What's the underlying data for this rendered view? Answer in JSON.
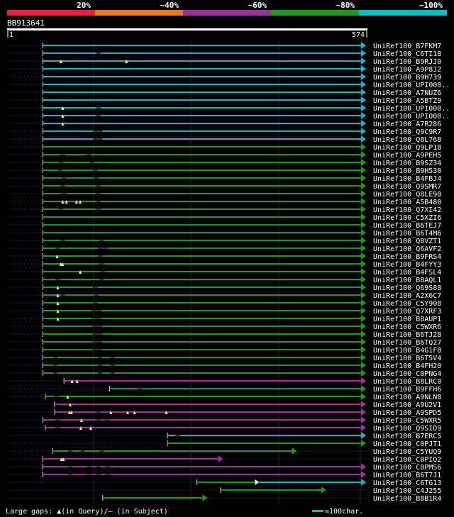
{
  "query": {
    "id": "BB913641",
    "start": "1",
    "end": "574"
  },
  "identity_scale": {
    "segments": [
      {
        "label": "20%",
        "color": "#e8213a"
      },
      {
        "label": "~40%",
        "color": "#e9781e"
      },
      {
        "label": "~60%",
        "color": "#9a2fa0"
      },
      {
        "label": "~80%",
        "color": "#1d9a1d"
      },
      {
        "label": "~100%",
        "color": "#13b8c8"
      }
    ]
  },
  "colors": {
    "background": "#000000",
    "cyan": "#13b8c8",
    "green": "#1d9a1d",
    "purple": "#a0309e",
    "white": "#ffffff",
    "grid": "#222222",
    "dotted": "#1d1d3a",
    "triangle": "#ffff66"
  },
  "legend": {
    "gaps_text": "Large gaps: ▲(in Query)/– (in Subject)",
    "scale_text": "=100char."
  },
  "hits": [
    {
      "label": "UniRef100_B7FKM7",
      "color": "cyan",
      "q_start": 56,
      "q_end": 574,
      "gaps": [],
      "thin": []
    },
    {
      "label": "UniRef100_C6TI18",
      "color": "cyan",
      "q_start": 56,
      "q_end": 574,
      "gaps": [],
      "thin": [
        145
      ]
    },
    {
      "label": "UniRef100_B9RJJ0",
      "color": "cyan",
      "q_start": 56,
      "q_end": 574,
      "gaps": [
        85,
        190
      ],
      "thin": []
    },
    {
      "label": "UniRef100_A9P8J2",
      "color": "cyan",
      "q_start": 56,
      "q_end": 574,
      "gaps": [],
      "thin": []
    },
    {
      "label": "UniRef100_B9H739",
      "color": "cyan",
      "q_start": 56,
      "q_end": 574,
      "gaps": [],
      "thin": []
    },
    {
      "label": "UniRef100_UPI000..",
      "color": "cyan",
      "q_start": 56,
      "q_end": 574,
      "gaps": [],
      "thin": []
    },
    {
      "label": "UniRef100_A7NUZ6",
      "color": "cyan",
      "q_start": 56,
      "q_end": 574,
      "gaps": [],
      "thin": []
    },
    {
      "label": "UniRef100_A5BTZ9",
      "color": "cyan",
      "q_start": 56,
      "q_end": 574,
      "gaps": [],
      "thin": []
    },
    {
      "label": "UniRef100_UPI000..",
      "color": "cyan",
      "q_start": 56,
      "q_end": 574,
      "gaps": [
        88
      ],
      "thin": [
        145
      ]
    },
    {
      "label": "UniRef100_UPI000..",
      "color": "cyan",
      "q_start": 56,
      "q_end": 574,
      "gaps": [
        88
      ],
      "thin": [
        145
      ]
    },
    {
      "label": "UniRef100_A7R286",
      "color": "cyan",
      "q_start": 56,
      "q_end": 574,
      "gaps": [
        88
      ],
      "thin": []
    },
    {
      "label": "UniRef100_Q9C9R7",
      "color": "cyan",
      "q_start": 56,
      "q_end": 574,
      "gaps": [],
      "thin": [
        140,
        148
      ]
    },
    {
      "label": "UniRef100_Q8L768",
      "color": "cyan",
      "q_start": 56,
      "q_end": 574,
      "gaps": [],
      "thin": [
        140,
        148
      ]
    },
    {
      "label": "UniRef100_Q9LP18",
      "color": "green",
      "q_start": 56,
      "q_end": 574,
      "gaps": [],
      "thin": []
    },
    {
      "label": "UniRef100_A9PEH5",
      "color": "green",
      "q_start": 56,
      "q_end": 574,
      "gaps": [],
      "thin": [
        88,
        130
      ]
    },
    {
      "label": "UniRef100_B9SZ34",
      "color": "green",
      "q_start": 56,
      "q_end": 574,
      "gaps": [],
      "thin": [
        85,
        135
      ]
    },
    {
      "label": "UniRef100_B9H530",
      "color": "green",
      "q_start": 56,
      "q_end": 574,
      "gaps": [],
      "thin": [
        84,
        140
      ]
    },
    {
      "label": "UniRef100_B4FBJ4",
      "color": "green",
      "q_start": 56,
      "q_end": 574,
      "gaps": [],
      "thin": [
        90,
        142
      ]
    },
    {
      "label": "UniRef100_Q9SMR7",
      "color": "green",
      "q_start": 56,
      "q_end": 574,
      "gaps": [],
      "thin": [
        88,
        145
      ]
    },
    {
      "label": "UniRef100_Q8LE90",
      "color": "green",
      "q_start": 56,
      "q_end": 574,
      "gaps": [],
      "thin": [
        90,
        145
      ]
    },
    {
      "label": "UniRef100_A5B480",
      "color": "green",
      "q_start": 56,
      "q_end": 574,
      "gaps": [
        88,
        94,
        110,
        116
      ],
      "thin": [
        145
      ]
    },
    {
      "label": "UniRef100_Q7XI42",
      "color": "green",
      "q_start": 56,
      "q_end": 574,
      "gaps": [],
      "thin": [
        85,
        145
      ]
    },
    {
      "label": "UniRef100_C5XZI6",
      "color": "green",
      "q_start": 56,
      "q_end": 574,
      "gaps": [],
      "thin": []
    },
    {
      "label": "UniRef100_B6TEJ7",
      "color": "green",
      "q_start": 56,
      "q_end": 574,
      "gaps": [],
      "thin": []
    },
    {
      "label": "UniRef100_B6T4M6",
      "color": "green",
      "q_start": 56,
      "q_end": 574,
      "gaps": [],
      "thin": []
    },
    {
      "label": "UniRef100_Q8VZT1",
      "color": "green",
      "q_start": 56,
      "q_end": 574,
      "gaps": [],
      "thin": [
        88,
        150
      ]
    },
    {
      "label": "UniRef100_Q6AVF2",
      "color": "green",
      "q_start": 56,
      "q_end": 574,
      "gaps": [],
      "thin": [
        80,
        148,
        156
      ]
    },
    {
      "label": "UniRef100_B9FRS4",
      "color": "green",
      "q_start": 56,
      "q_end": 574,
      "gaps": [
        79
      ],
      "thin": [
        148
      ]
    },
    {
      "label": "UniRef100_B4FYY3",
      "color": "green",
      "q_start": 56,
      "q_end": 574,
      "gaps": [
        85,
        88
      ],
      "thin": [
        150
      ]
    },
    {
      "label": "UniRef100_B4FSL4",
      "color": "green",
      "q_start": 56,
      "q_end": 574,
      "gaps": [
        116
      ],
      "thin": [
        152
      ]
    },
    {
      "label": "UniRef100_B8AQL1",
      "color": "green",
      "q_start": 56,
      "q_end": 574,
      "gaps": [],
      "thin": [
        80,
        150
      ]
    },
    {
      "label": "UniRef100_Q69S88",
      "color": "green",
      "q_start": 56,
      "q_end": 574,
      "gaps": [
        80
      ],
      "thin": [
        140
      ]
    },
    {
      "label": "UniRef100_A2X6C7",
      "color": "green",
      "q_start": 56,
      "q_end": 574,
      "gaps": [
        80
      ],
      "thin": [
        88,
        142
      ]
    },
    {
      "label": "UniRef100_C5Y908",
      "color": "green",
      "q_start": 56,
      "q_end": 574,
      "gaps": [
        80
      ],
      "thin": [
        140
      ]
    },
    {
      "label": "UniRef100_Q7XRF3",
      "color": "green",
      "q_start": 56,
      "q_end": 574,
      "gaps": [
        80
      ],
      "thin": [
        138,
        146
      ]
    },
    {
      "label": "UniRef100_B8AUP1",
      "color": "green",
      "q_start": 56,
      "q_end": 574,
      "gaps": [
        80
      ],
      "thin": [
        138,
        146
      ]
    },
    {
      "label": "UniRef100_C5WXR6",
      "color": "green",
      "q_start": 56,
      "q_end": 574,
      "gaps": [],
      "thin": [
        140,
        148
      ]
    },
    {
      "label": "UniRef100_B6TJ28",
      "color": "green",
      "q_start": 56,
      "q_end": 574,
      "gaps": [],
      "thin": [
        140,
        148
      ]
    },
    {
      "label": "UniRef100_B6TQ27",
      "color": "green",
      "q_start": 56,
      "q_end": 574,
      "gaps": [],
      "thin": [
        140,
        148
      ]
    },
    {
      "label": "UniRef100_B4G1F8",
      "color": "green",
      "q_start": 56,
      "q_end": 574,
      "gaps": [],
      "thin": [
        140,
        148
      ]
    },
    {
      "label": "UniRef100_B6T5V4",
      "color": "green",
      "q_start": 56,
      "q_end": 574,
      "gaps": [],
      "thin": [
        76,
        148,
        168
      ]
    },
    {
      "label": "UniRef100_B4FH20",
      "color": "green",
      "q_start": 56,
      "q_end": 574,
      "gaps": [],
      "thin": [
        76,
        148,
        168
      ]
    },
    {
      "label": "UniRef100_C0PNG4",
      "color": "green",
      "q_start": 56,
      "q_end": 574,
      "gaps": [],
      "thin": [
        76,
        148,
        168
      ]
    },
    {
      "label": "UniRef100_B8LRC0",
      "color": "purple",
      "q_start": 90,
      "q_end": 574,
      "gaps": [
        103,
        111
      ],
      "thin": []
    },
    {
      "label": "UniRef100_B9FFH6",
      "color": "green",
      "q_start": 163,
      "q_end": 574,
      "gaps": [],
      "thin": [
        212
      ]
    },
    {
      "label": "UniRef100_A9NLN8",
      "color": "green",
      "q_start": 60,
      "q_end": 574,
      "gaps": [
        96
      ],
      "thin": [
        78
      ]
    },
    {
      "label": "UniRef100_A9U2V1",
      "color": "purple",
      "q_start": 75,
      "q_end": 574,
      "gaps": [
        100
      ],
      "thin": []
    },
    {
      "label": "UniRef100_A9SPD5",
      "color": "purple",
      "q_start": 75,
      "q_end": 574,
      "gaps": [
        99,
        102,
        165,
        192,
        203,
        254
      ],
      "thin": [
        145
      ]
    },
    {
      "label": "UniRef100_C5WXR5",
      "color": "purple",
      "q_start": 56,
      "q_end": 574,
      "gaps": [
        118
      ],
      "thin": [
        80,
        145,
        160
      ]
    },
    {
      "label": "UniRef100_Q9SID9",
      "color": "purple",
      "q_start": 60,
      "q_end": 574,
      "gaps": [
        117,
        133
      ],
      "thin": [
        80
      ]
    },
    {
      "label": "UniRef100_B7ERC5",
      "color": "cyan",
      "q_start": 256,
      "q_end": 574,
      "gaps": [],
      "thin": [
        272
      ]
    },
    {
      "label": "UniRef100_C0PJT1",
      "color": "green",
      "q_start": 256,
      "q_end": 574,
      "gaps": [],
      "thin": []
    },
    {
      "label": "UniRef100_C5YUQ9",
      "color": "green",
      "q_start": 72,
      "q_end": 463,
      "gaps": [],
      "thin": [
        100,
        120,
        150
      ]
    },
    {
      "label": "UniRef100_C0PIQ2",
      "color": "purple",
      "q_start": 56,
      "q_end": 345,
      "gaps": [
        86,
        89
      ],
      "thin": []
    },
    {
      "label": "UniRef100_C0PMS6",
      "color": "purple",
      "q_start": 56,
      "q_end": 574,
      "gaps": [],
      "thin": [
        100,
        130,
        145,
        160
      ]
    },
    {
      "label": "UniRef100_B6T7J1",
      "color": "purple",
      "q_start": 56,
      "q_end": 574,
      "gaps": [],
      "thin": [
        100,
        130,
        145,
        160
      ]
    },
    {
      "label": "UniRef100_C6TG13",
      "color": "green",
      "q_start": 303,
      "q_end": 574,
      "gaps": [],
      "thin": [],
      "cyan_from": 396
    },
    {
      "label": "UniRef100_C4J255",
      "color": "green",
      "q_start": 341,
      "q_end": 510,
      "gaps": [],
      "thin": []
    },
    {
      "label": "UniRef100_B8B1R4",
      "color": "green",
      "q_start": 152,
      "q_end": 320,
      "gaps": [],
      "thin": []
    }
  ]
}
